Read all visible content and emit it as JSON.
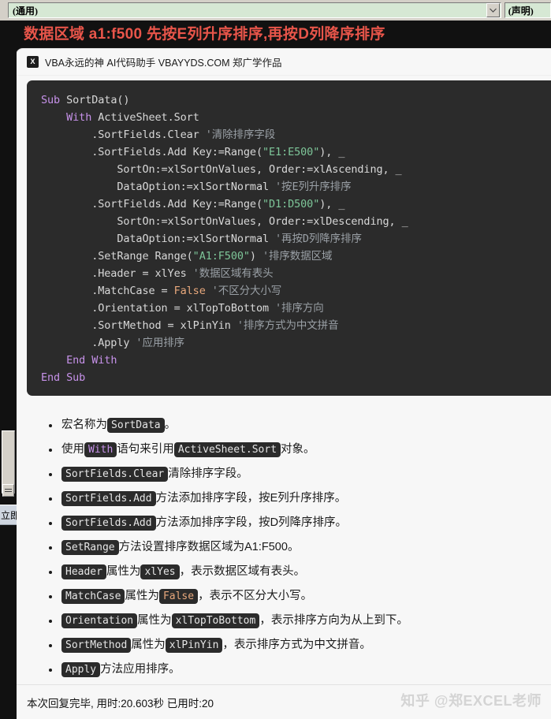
{
  "vbe": {
    "object_combo_value": "(通用)",
    "procedure_combo_value": "(声明)",
    "dropdown_icon": "chevron-down-icon",
    "immediate_window_label": "立即"
  },
  "prompt": {
    "heading": "数据区域 a1:f500 先按E列升序排序,再按D列降序排序"
  },
  "brand": {
    "icon": "xlsx-file-icon",
    "icon_glyph": "X",
    "text": "VBA永远的神 AI代码助手 VBAYYDS.COM 郑广学作品"
  },
  "code": {
    "language": "vba",
    "lines": [
      "Sub SortData()",
      "    With ActiveSheet.Sort",
      "        .SortFields.Clear '清除排序字段",
      "        .SortFields.Add Key:=Range(\"E1:E500\"), _",
      "            SortOn:=xlSortOnValues, Order:=xlAscending, _",
      "            DataOption:=xlSortNormal '按E列升序排序",
      "        .SortFields.Add Key:=Range(\"D1:D500\"), _",
      "            SortOn:=xlSortOnValues, Order:=xlDescending, _",
      "            DataOption:=xlSortNormal '再按D列降序排序",
      "        .SetRange Range(\"A1:F500\") '排序数据区域",
      "        .Header = xlYes '数据区域有表头",
      "        .MatchCase = False '不区分大小写",
      "        .Orientation = xlTopToBottom '排序方向",
      "        .SortMethod = xlPinYin '排序方式为中文拼音",
      "        .Apply '应用排序",
      "    End With",
      "End Sub"
    ]
  },
  "explanation": {
    "bullets": [
      {
        "parts": [
          {
            "t": "text",
            "v": "宏名称为"
          },
          {
            "t": "code",
            "v": "SortData"
          },
          {
            "t": "text",
            "v": "。"
          }
        ]
      },
      {
        "parts": [
          {
            "t": "text",
            "v": "使用"
          },
          {
            "t": "code-kw",
            "v": "With"
          },
          {
            "t": "text",
            "v": "语句来引用"
          },
          {
            "t": "code",
            "v": "ActiveSheet.Sort"
          },
          {
            "t": "text",
            "v": "对象。"
          }
        ]
      },
      {
        "parts": [
          {
            "t": "code",
            "v": "SortFields.Clear"
          },
          {
            "t": "text",
            "v": "清除排序字段。"
          }
        ]
      },
      {
        "parts": [
          {
            "t": "code",
            "v": "SortFields.Add"
          },
          {
            "t": "text",
            "v": "方法添加排序字段，按E列升序排序。"
          }
        ]
      },
      {
        "parts": [
          {
            "t": "code",
            "v": "SortFields.Add"
          },
          {
            "t": "text",
            "v": "方法添加排序字段，按D列降序排序。"
          }
        ]
      },
      {
        "parts": [
          {
            "t": "code",
            "v": "SetRange"
          },
          {
            "t": "text",
            "v": "方法设置排序数据区域为A1:F500。"
          }
        ]
      },
      {
        "parts": [
          {
            "t": "code",
            "v": "Header"
          },
          {
            "t": "text",
            "v": "属性为"
          },
          {
            "t": "code",
            "v": "xlYes"
          },
          {
            "t": "text",
            "v": "，表示数据区域有表头。"
          }
        ]
      },
      {
        "parts": [
          {
            "t": "code",
            "v": "MatchCase"
          },
          {
            "t": "text",
            "v": "属性为"
          },
          {
            "t": "code-num",
            "v": "False"
          },
          {
            "t": "text",
            "v": "，表示不区分大小写。"
          }
        ]
      },
      {
        "parts": [
          {
            "t": "code",
            "v": "Orientation"
          },
          {
            "t": "text",
            "v": "属性为"
          },
          {
            "t": "code",
            "v": "xlTopToBottom"
          },
          {
            "t": "text",
            "v": "，表示排序方向为从上到下。"
          }
        ]
      },
      {
        "parts": [
          {
            "t": "code",
            "v": "SortMethod"
          },
          {
            "t": "text",
            "v": "属性为"
          },
          {
            "t": "code",
            "v": "xlPinYin"
          },
          {
            "t": "text",
            "v": "，表示排序方式为中文拼音。"
          }
        ]
      },
      {
        "parts": [
          {
            "t": "code",
            "v": "Apply"
          },
          {
            "t": "text",
            "v": "方法应用排序。"
          }
        ]
      }
    ]
  },
  "footer": {
    "status_text": "本次回复完毕, 用时:20.603秒 已用时:20",
    "watermark": "知乎 @郑EXCEL老师"
  },
  "colors": {
    "prompt_red": "#e8554a",
    "code_bg": "#2b2b2b",
    "keyword": "#c792ea",
    "string": "#7ec699",
    "comment": "#9aa0a6",
    "literal": "#e8a87c",
    "combo_bg": "#d6e8d4"
  }
}
